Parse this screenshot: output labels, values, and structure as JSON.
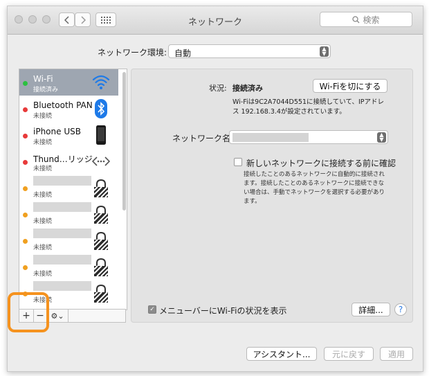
{
  "window": {
    "title": "ネットワーク"
  },
  "toolbar": {
    "back_icon": "chevron-left",
    "forward_icon": "chevron-right",
    "grid_icon": "grid-dots",
    "search_placeholder": "検索"
  },
  "environment": {
    "label": "ネットワーク環境:",
    "value": "自動"
  },
  "services": [
    {
      "name": "Wi-Fi",
      "status": "接続済み",
      "color": "#2bc140",
      "icon": "wifi-icon",
      "selected": true
    },
    {
      "name": "Bluetooth PAN",
      "status": "未接続",
      "color": "#e83a3a",
      "icon": "bluetooth-icon"
    },
    {
      "name": "iPhone USB",
      "status": "未接続",
      "color": "#e83a3a",
      "icon": "iphone-icon"
    },
    {
      "name": "Thund…リッジ",
      "status": "未接続",
      "color": "#e83a3a",
      "icon": "thunderbolt-bridge-icon"
    },
    {
      "name": "",
      "status": "未接続",
      "color": "#f0a020",
      "icon": "lock-icon"
    },
    {
      "name": "",
      "status": "未接続",
      "color": "#f0a020",
      "icon": "lock-icon"
    },
    {
      "name": "",
      "status": "未接続",
      "color": "#f0a020",
      "icon": "lock-icon"
    },
    {
      "name": "",
      "status": "未接続",
      "color": "#f0a020",
      "icon": "lock-icon"
    },
    {
      "name": "",
      "status": "未接続",
      "color": "#f0a020",
      "icon": "lock-icon"
    }
  ],
  "list_buttons": {
    "add": "+",
    "remove": "−",
    "action": "⚙︎⌄"
  },
  "detail": {
    "status_label": "状況:",
    "status_value": "接続済み",
    "wifi_off_button": "Wi-Fiを切にする",
    "status_desc_line1": "Wi-Fiは9C2A7044D551に接続していて、IPアドレ",
    "status_desc_line2": "ス 192.168.3.4が設定されています。",
    "network_name_label": "ネットワーク名:",
    "network_name_value": "",
    "ask_join_label": "新しいネットワークに接続する前に確認",
    "ask_join_checked": false,
    "ask_join_desc": [
      "接続したことのあるネットワークに自動的に接続され",
      "ます。接続したことのあるネットワークに接続できな",
      "い場合は、手動でネットワークを選択する必要があり",
      "ます。"
    ],
    "menubar_label": "メニューバーにWi-Fiの状況を表示",
    "menubar_checked": true,
    "advanced_button": "詳細...",
    "help": "?"
  },
  "footer": {
    "assistant": "アシスタント...",
    "revert": "元に戻す",
    "apply": "適用"
  },
  "colors": {
    "highlight": "#f5921e",
    "selection": "#9ea6b1",
    "help_blue": "#2a7ae2"
  }
}
